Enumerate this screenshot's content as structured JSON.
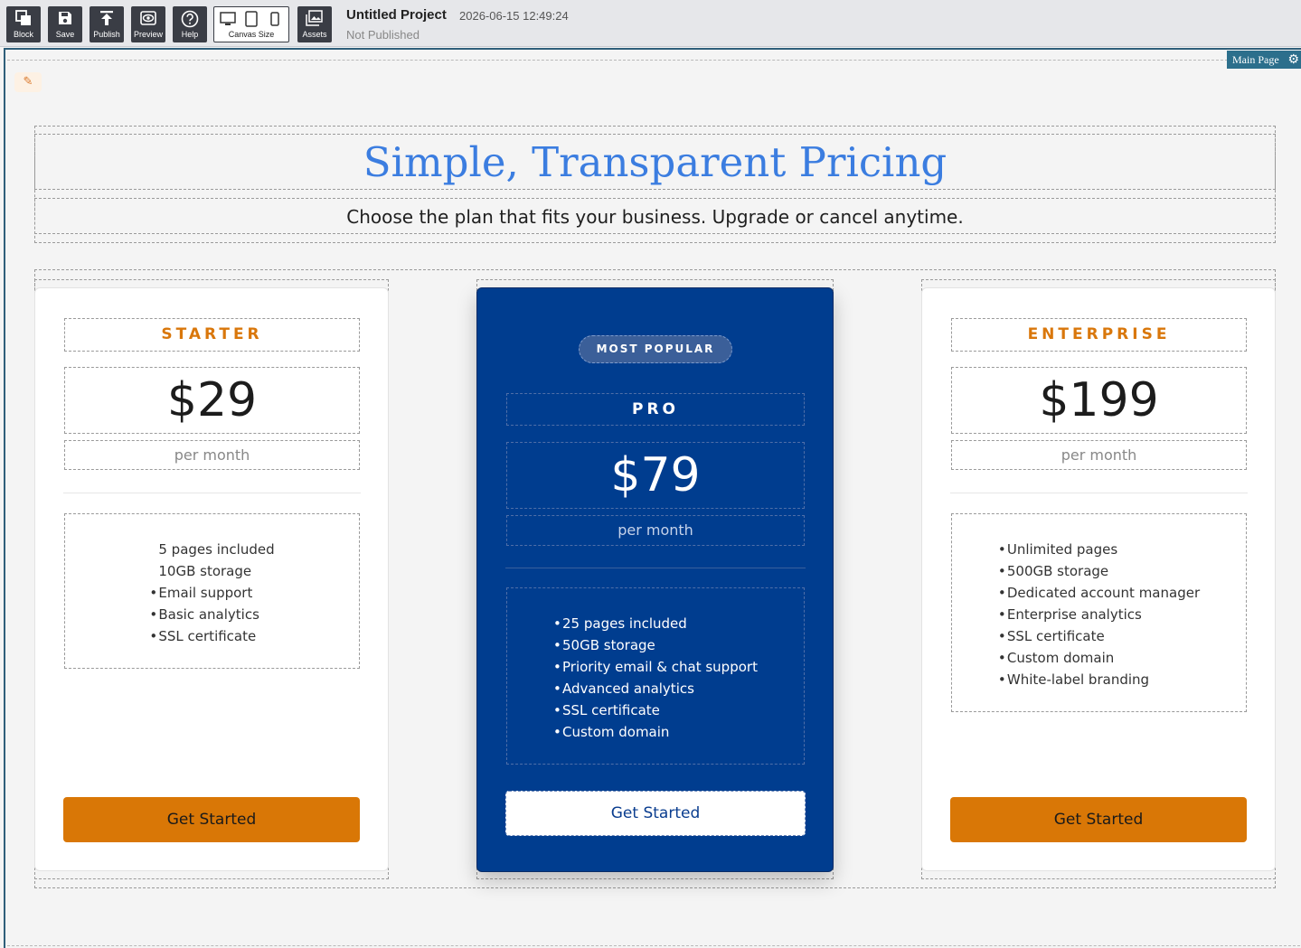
{
  "toolbar": {
    "buttons": [
      {
        "label": "Block",
        "icon": "block-icon"
      },
      {
        "label": "Save",
        "icon": "save-icon"
      },
      {
        "label": "Publish",
        "icon": "upload-icon"
      },
      {
        "label": "Preview",
        "icon": "eye-icon"
      },
      {
        "label": "Help",
        "icon": "question-icon"
      }
    ],
    "canvas_size_label": "Canvas Size",
    "assets_label": "Assets"
  },
  "project": {
    "title": "Untitled Project",
    "timestamp": "2026-06-15 12:49:24",
    "status": "Not Published"
  },
  "page_tag": "Main Page",
  "hero": {
    "title": "Simple, Transparent Pricing",
    "subtitle": "Choose the plan that fits your business. Upgrade or cancel anytime."
  },
  "plans": [
    {
      "name": "STARTER",
      "price": "$29",
      "period": "per month",
      "features": [
        {
          "bullet": "",
          "text": "5 pages included"
        },
        {
          "bullet": "",
          "text": "10GB storage"
        },
        {
          "bullet": "•",
          "text": "Email support"
        },
        {
          "bullet": "•",
          "text": "Basic analytics"
        },
        {
          "bullet": "•",
          "text": "SSL certificate"
        }
      ],
      "cta": "Get Started"
    },
    {
      "badge": "MOST POPULAR",
      "name": "PRO",
      "price": "$79",
      "period": "per month",
      "features": [
        {
          "bullet": "•",
          "text": "25 pages included"
        },
        {
          "bullet": "•",
          "text": "50GB storage"
        },
        {
          "bullet": "•",
          "text": "Priority email & chat support"
        },
        {
          "bullet": "•",
          "text": "Advanced analytics"
        },
        {
          "bullet": "•",
          "text": "SSL certificate"
        },
        {
          "bullet": "•",
          "text": "Custom domain"
        }
      ],
      "cta": "Get Started"
    },
    {
      "name": "ENTERPRISE",
      "price": "$199",
      "period": "per month",
      "features": [
        {
          "bullet": "•",
          "text": "Unlimited pages"
        },
        {
          "bullet": "•",
          "text": "500GB storage"
        },
        {
          "bullet": "•",
          "text": "Dedicated account manager"
        },
        {
          "bullet": "•",
          "text": "Enterprise analytics"
        },
        {
          "bullet": "•",
          "text": "SSL certificate"
        },
        {
          "bullet": "•",
          "text": "Custom domain"
        },
        {
          "bullet": "•",
          "text": "White-label branding"
        }
      ],
      "cta": "Get Started"
    }
  ],
  "colors": {
    "accent_orange": "#d97706",
    "title_blue": "#3b7de0",
    "featured_navy": "#003d8f",
    "toolbar_dark": "#3a3d45"
  }
}
